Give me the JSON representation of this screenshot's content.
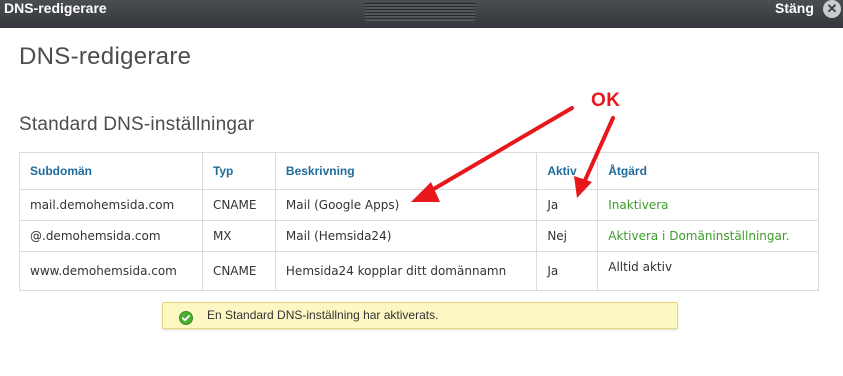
{
  "window": {
    "title": "DNS-redigerare",
    "close_label": "Stäng",
    "close_icon": "close-icon"
  },
  "page": {
    "title": "DNS-redigerare",
    "section_title": "Standard DNS-inställningar"
  },
  "table": {
    "headers": [
      "Subdomän",
      "Typ",
      "Beskrivning",
      "Aktiv",
      "Åtgärd"
    ],
    "rows": [
      {
        "subdomain": "mail.demohemsida.com",
        "type": "CNAME",
        "description": "Mail (Google Apps)",
        "active": "Ja",
        "action": "Inaktivera"
      },
      {
        "subdomain": "@.demohemsida.com",
        "type": "MX",
        "description": "Mail (Hemsida24)",
        "active": "Nej",
        "action": "Aktivera i Domäninställningar."
      },
      {
        "subdomain": "www.demohemsida.com",
        "type": "CNAME",
        "description": "Hemsida24 kopplar ditt domännamn",
        "active": "Ja",
        "action": "Alltid aktiv"
      }
    ],
    "colors": {
      "header_text": "#1f6b9a",
      "action_link": "#3c9b2b"
    }
  },
  "notice": {
    "message": "En Standard DNS-inställning har aktiverats.",
    "icon": "check-circle-icon",
    "colors": {
      "background": "#fdf7c4",
      "icon": "#4caf30"
    }
  },
  "annotation": {
    "label": "OK",
    "color": "#e8171b"
  }
}
